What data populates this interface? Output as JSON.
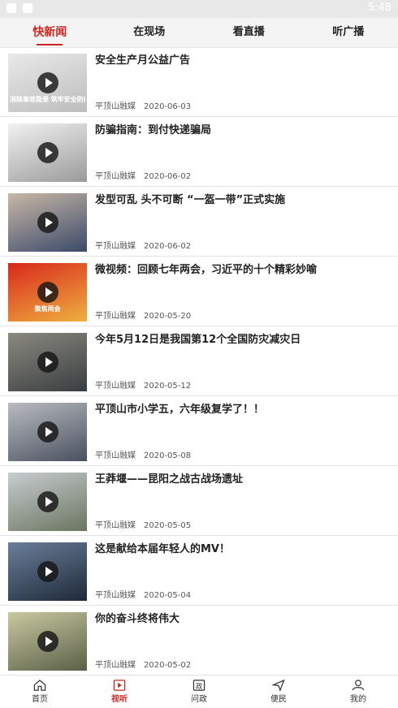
{
  "status": {
    "time": "5:48"
  },
  "tabs": [
    {
      "label": "快新闻",
      "active": true
    },
    {
      "label": "在现场",
      "active": false
    },
    {
      "label": "看直播",
      "active": false
    },
    {
      "label": "听广播",
      "active": false
    }
  ],
  "items": [
    {
      "title": "安全生产月公益广告",
      "source": "平顶山融媒",
      "date": "2020-06-03",
      "thumb_text": "消除事故隐患 筑牢安全防线",
      "thumb_colors": [
        "#e9e9e9",
        "#bdbdbd"
      ]
    },
    {
      "title": "防骗指南：到付快递骗局",
      "source": "平顶山融媒",
      "date": "2020-06-02",
      "thumb_text": "",
      "thumb_colors": [
        "#f2f2f2",
        "#9a9a9a"
      ]
    },
    {
      "title": "发型可乱 头不可断 “一盔一带”正式实施",
      "source": "平顶山融媒",
      "date": "2020-06-02",
      "thumb_text": "",
      "thumb_colors": [
        "#c9b8a6",
        "#3b4a6a"
      ]
    },
    {
      "title": "微视频：回顾七年两会，习近平的十个精彩妙喻",
      "source": "平顶山融媒",
      "date": "2020-05-20",
      "thumb_text": "聚焦两会",
      "thumb_colors": [
        "#d8281c",
        "#f0b040"
      ]
    },
    {
      "title": "今年5月12日是我国第12个全国防灾减灾日",
      "source": "平顶山融媒",
      "date": "2020-05-12",
      "thumb_text": "",
      "thumb_colors": [
        "#8a8a80",
        "#3a3d40"
      ]
    },
    {
      "title": "平顶山市小学五，六年级复学了！！",
      "source": "平顶山融媒",
      "date": "2020-05-08",
      "thumb_text": "",
      "thumb_colors": [
        "#b9bcc0",
        "#4a5060"
      ]
    },
    {
      "title": "王莽堰——昆阳之战古战场遗址",
      "source": "平顶山融媒",
      "date": "2020-05-05",
      "thumb_text": "",
      "thumb_colors": [
        "#c8ccd0",
        "#6b7560"
      ]
    },
    {
      "title": "这是献给本届年轻人的MV！",
      "source": "平顶山融媒",
      "date": "2020-05-04",
      "thumb_text": "",
      "thumb_colors": [
        "#6a7e98",
        "#1f2a3a"
      ]
    },
    {
      "title": "你的奋斗终将伟大",
      "source": "平顶山融媒",
      "date": "2020-05-02",
      "thumb_text": "",
      "thumb_colors": [
        "#c9c8a0",
        "#5a6048"
      ]
    }
  ],
  "nav": [
    {
      "label": "首页",
      "icon": "home-icon",
      "active": false
    },
    {
      "label": "视听",
      "icon": "video-icon",
      "active": true
    },
    {
      "label": "问政",
      "icon": "politics-icon",
      "active": false
    },
    {
      "label": "便民",
      "icon": "send-icon",
      "active": false
    },
    {
      "label": "我的",
      "icon": "user-icon",
      "active": false
    }
  ],
  "colors": {
    "accent": "#d0261f"
  }
}
